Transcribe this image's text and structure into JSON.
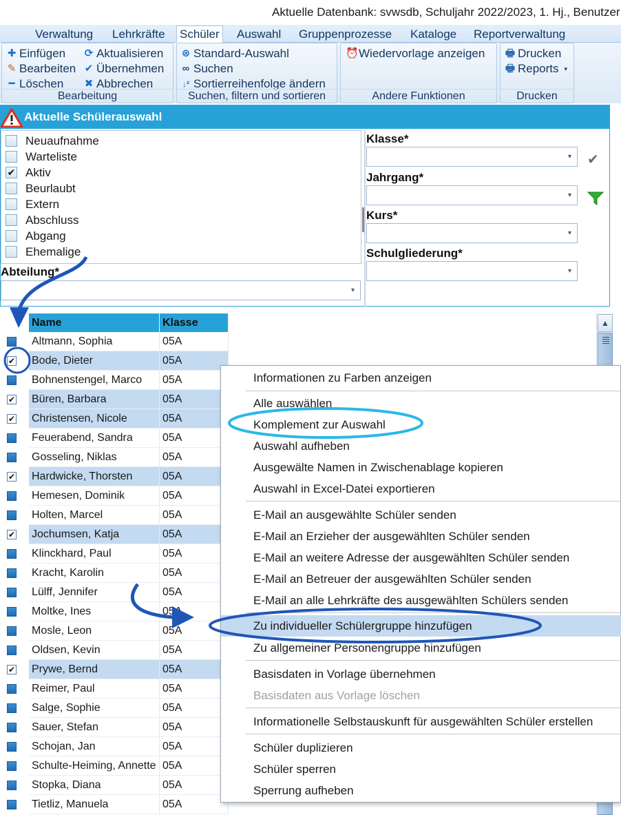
{
  "titlebar": {
    "text": "Aktuelle Datenbank: svwsdb, Schuljahr 2022/2023, 1. Hj., Benutzer"
  },
  "menu": {
    "tabs": [
      "Verwaltung",
      "Lehrkräfte",
      "Schüler",
      "Auswahl",
      "Gruppenprozesse",
      "Kataloge",
      "Reportverwaltung"
    ],
    "active": "Schüler"
  },
  "ribbon": {
    "bearbeitung": {
      "label": "Bearbeitung",
      "einfuegen": "Einfügen",
      "bearbeiten": "Bearbeiten",
      "loeschen": "Löschen",
      "aktualisieren": "Aktualisieren",
      "uebernehmen": "Übernehmen",
      "abbrechen": "Abbrechen"
    },
    "suchen": {
      "label": "Suchen, filtern und sortieren",
      "standard": "Standard-Auswahl",
      "suchen": "Suchen",
      "sortierung": "Sortierreihenfolge ändern"
    },
    "andere": {
      "label": "Andere Funktionen",
      "wiedervorlage": "Wiedervorlage anzeigen"
    },
    "drucken": {
      "label": "Drucken",
      "drucken": "Drucken",
      "reports": "Reports"
    }
  },
  "panel": {
    "title": "Aktuelle Schülerauswahl",
    "statuses": [
      {
        "label": "Neuaufnahme",
        "checked": false
      },
      {
        "label": "Warteliste",
        "checked": false
      },
      {
        "label": "Aktiv",
        "checked": true
      },
      {
        "label": "Beurlaubt",
        "checked": false
      },
      {
        "label": "Extern",
        "checked": false
      },
      {
        "label": "Abschluss",
        "checked": false
      },
      {
        "label": "Abgang",
        "checked": false
      },
      {
        "label": "Ehemalige",
        "checked": false
      }
    ],
    "abteilung_label": "Abteilung*",
    "klasse_label": "Klasse*",
    "jahrgang_label": "Jahrgang*",
    "kurs_label": "Kurs*",
    "schulgliederung_label": "Schulgliederung*"
  },
  "grid": {
    "headers": {
      "name": "Name",
      "klasse": "Klasse"
    },
    "rows": [
      {
        "name": "Altmann, Sophia",
        "klasse": "05A",
        "checked": false
      },
      {
        "name": "Bode, Dieter",
        "klasse": "05A",
        "checked": true
      },
      {
        "name": "Bohnenstengel, Marco",
        "klasse": "05A",
        "checked": false
      },
      {
        "name": "Büren, Barbara",
        "klasse": "05A",
        "checked": true
      },
      {
        "name": "Christensen, Nicole",
        "klasse": "05A",
        "checked": true
      },
      {
        "name": "Feuerabend, Sandra",
        "klasse": "05A",
        "checked": false
      },
      {
        "name": "Gosseling, Niklas",
        "klasse": "05A",
        "checked": false
      },
      {
        "name": "Hardwicke, Thorsten",
        "klasse": "05A",
        "checked": true
      },
      {
        "name": "Hemesen, Dominik",
        "klasse": "05A",
        "checked": false
      },
      {
        "name": "Holten, Marcel",
        "klasse": "05A",
        "checked": false
      },
      {
        "name": "Jochumsen, Katja",
        "klasse": "05A",
        "checked": true
      },
      {
        "name": "Klinckhard, Paul",
        "klasse": "05A",
        "checked": false
      },
      {
        "name": "Kracht, Karolin",
        "klasse": "05A",
        "checked": false
      },
      {
        "name": "Lülff, Jennifer",
        "klasse": "05A",
        "checked": false
      },
      {
        "name": "Moltke, Ines",
        "klasse": "05A",
        "checked": false
      },
      {
        "name": "Mosle, Leon",
        "klasse": "05A",
        "checked": false
      },
      {
        "name": "Oldsen, Kevin",
        "klasse": "05A",
        "checked": false
      },
      {
        "name": "Prywe, Bernd",
        "klasse": "05A",
        "checked": true
      },
      {
        "name": "Reimer, Paul",
        "klasse": "05A",
        "checked": false
      },
      {
        "name": "Salge, Sophie",
        "klasse": "05A",
        "checked": false
      },
      {
        "name": "Sauer, Stefan",
        "klasse": "05A",
        "checked": false
      },
      {
        "name": "Schojan, Jan",
        "klasse": "05A",
        "checked": false
      },
      {
        "name": "Schulte-Heiming, Annette",
        "klasse": "05A",
        "checked": false
      },
      {
        "name": "Stopka, Diana",
        "klasse": "05A",
        "checked": false
      },
      {
        "name": "Tietliz, Manuela",
        "klasse": "05A",
        "checked": false
      }
    ]
  },
  "context_menu": {
    "items": [
      {
        "label": "Informationen zu Farben anzeigen"
      },
      {
        "label": "Alle auswählen"
      },
      {
        "label": "Komplement zur Auswahl"
      },
      {
        "label": "Auswahl aufheben"
      },
      {
        "label": "Ausgewälte Namen in Zwischenablage kopieren"
      },
      {
        "label": "Auswahl in Excel-Datei exportieren"
      },
      {
        "label": "E-Mail an ausgewählte Schüler senden"
      },
      {
        "label": "E-Mail an Erzieher der ausgewählten Schüler senden"
      },
      {
        "label": "E-Mail an weitere Adresse der ausgewählten Schüler senden"
      },
      {
        "label": "E-Mail an Betreuer der ausgewählten Schüler senden"
      },
      {
        "label": "E-Mail an alle Lehrkräfte des ausgewählten Schülers senden"
      },
      {
        "label": "Zu individueller Schülergruppe hinzufügen",
        "highlighted": true
      },
      {
        "label": "Zu allgemeiner Personengruppe hinzufügen"
      },
      {
        "label": "Basisdaten in Vorlage übernehmen"
      },
      {
        "label": "Basisdaten aus Vorlage löschen",
        "disabled": true
      },
      {
        "label": "Informationelle Selbstauskunft für ausgewählten Schüler erstellen"
      },
      {
        "label": "Schüler duplizieren"
      },
      {
        "label": "Schüler sperren"
      },
      {
        "label": "Sperrung aufheben"
      }
    ]
  },
  "colors": {
    "header_blue": "#27a2d8",
    "selection": "#c3daf1",
    "annotation_cyan": "#2bb8e6",
    "annotation_blue": "#1f56b8"
  }
}
